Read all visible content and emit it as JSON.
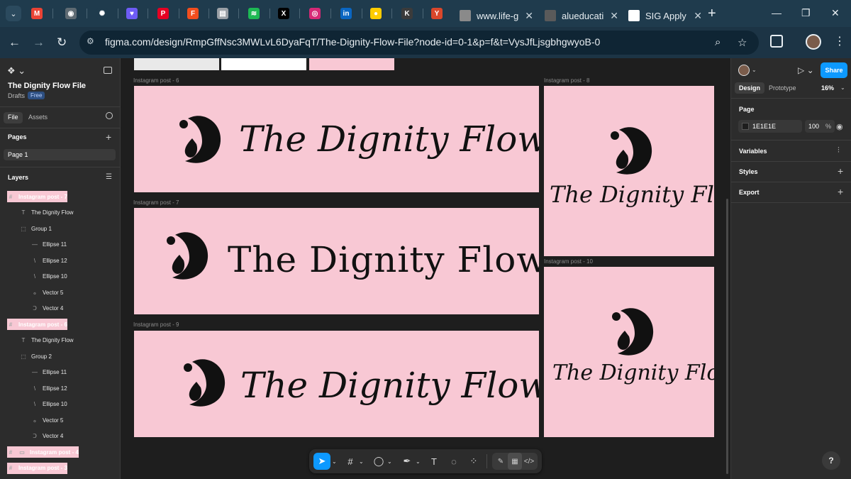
{
  "browser": {
    "tabs": [
      {
        "title": "www.life-g",
        "fav_color": "#8a8a8a"
      },
      {
        "title": "alueducati",
        "fav_color": "#5a5a5a"
      },
      {
        "title": "SIG Apply",
        "fav_color": "#ffffff"
      }
    ],
    "pinned": [
      {
        "name": "gmail-icon",
        "glyph": "M",
        "color": "#ea4335"
      },
      {
        "name": "globe-icon",
        "glyph": "◉",
        "color": "#5f6b73"
      },
      {
        "name": "chatgpt-icon",
        "glyph": "✺",
        "color": "#1f3b4d"
      },
      {
        "name": "heart-app-icon",
        "glyph": "♥",
        "color": "#6e5cf5"
      },
      {
        "name": "pinterest-icon",
        "glyph": "P",
        "color": "#e60023"
      },
      {
        "name": "figma-icon",
        "glyph": "F",
        "color": "#f24e1e"
      },
      {
        "name": "slides-icon",
        "glyph": "▤",
        "color": "#9aa0a6"
      },
      {
        "name": "spotify-icon",
        "glyph": "≋",
        "color": "#1db954"
      },
      {
        "name": "x-icon",
        "glyph": "X",
        "color": "#000000"
      },
      {
        "name": "instagram-icon",
        "glyph": "◎",
        "color": "#d62976"
      },
      {
        "name": "linkedin-icon",
        "glyph": "in",
        "color": "#0a66c2"
      },
      {
        "name": "mtn-icon",
        "glyph": "●",
        "color": "#ffcc00"
      },
      {
        "name": "k-icon",
        "glyph": "K",
        "color": "#3b3b3b"
      },
      {
        "name": "y-app-icon",
        "glyph": "Y",
        "color": "#d9472b"
      }
    ],
    "url": "figma.com/design/RmpGffNsc3MWLvL6DyaFqT/The-Dignity-Flow-File?node-id=0-1&p=f&t=VysJfLjsgbhgwyoB-0"
  },
  "left_panel": {
    "file_name": "The Dignity Flow File",
    "drafts": "Drafts",
    "badge": "Free",
    "tab_file": "File",
    "tab_assets": "Assets",
    "pages_title": "Pages",
    "current_page": "Page 1",
    "layers_title": "Layers",
    "layers": [
      {
        "icon": "#",
        "label": "Instagram post - 7",
        "kind": "frame"
      },
      {
        "icon": "T",
        "label": "The Dignity Flow",
        "kind": "text"
      },
      {
        "icon": "⬚",
        "label": "Group 1",
        "kind": "group"
      },
      {
        "icon": "—",
        "label": "Ellipse 11",
        "kind": "vector"
      },
      {
        "icon": "\\",
        "label": "Ellipse 12",
        "kind": "vector"
      },
      {
        "icon": "\\",
        "label": "Ellipse 10",
        "kind": "vector"
      },
      {
        "icon": "ℴ",
        "label": "Vector 5",
        "kind": "vector"
      },
      {
        "icon": "Ↄ",
        "label": "Vector 4",
        "kind": "vector"
      },
      {
        "icon": "#",
        "label": "Instagram post - 6",
        "kind": "frame"
      },
      {
        "icon": "T",
        "label": "The Dignity Flow",
        "kind": "text"
      },
      {
        "icon": "⬚",
        "label": "Group 2",
        "kind": "group"
      },
      {
        "icon": "—",
        "label": "Ellipse 11",
        "kind": "vector"
      },
      {
        "icon": "\\",
        "label": "Ellipse 12",
        "kind": "vector"
      },
      {
        "icon": "\\",
        "label": "Ellipse 10",
        "kind": "vector"
      },
      {
        "icon": "ℴ",
        "label": "Vector 5",
        "kind": "vector"
      },
      {
        "icon": "Ↄ",
        "label": "Vector 4",
        "kind": "vector"
      },
      {
        "icon": "▭",
        "label": "Instagram post - 4",
        "kind": "frame"
      },
      {
        "icon": "#",
        "label": "Instagram post - 3",
        "kind": "frame"
      }
    ]
  },
  "canvas": {
    "frames": [
      {
        "label": "Instagram post - 6",
        "text": "The Dignity Flow"
      },
      {
        "label": "Instagram post - 7",
        "text": "The Dignity Flow"
      },
      {
        "label": "Instagram post - 9",
        "text": "The Dignity Flow"
      },
      {
        "label": "Instagram post - 8",
        "text": "The Dignity Flow"
      },
      {
        "label": "Instagram post - 10",
        "text": "The Dignity Flow"
      }
    ],
    "frame_color": "#f8c8d4"
  },
  "toolbar": {
    "tools": [
      "move-tool",
      "frame-tool",
      "shape-tool",
      "pen-tool",
      "text-tool",
      "comment-tool",
      "actions-tool"
    ],
    "modes": [
      "draw-mode",
      "design-mode",
      "dev-mode"
    ]
  },
  "right_panel": {
    "share": "Share",
    "tab_design": "Design",
    "tab_prototype": "Prototype",
    "zoom": "16%",
    "page_title": "Page",
    "bg_hex": "1E1E1E",
    "bg_opacity": "100",
    "pct": "%",
    "variables": "Variables",
    "styles": "Styles",
    "export": "Export",
    "help": "?"
  }
}
